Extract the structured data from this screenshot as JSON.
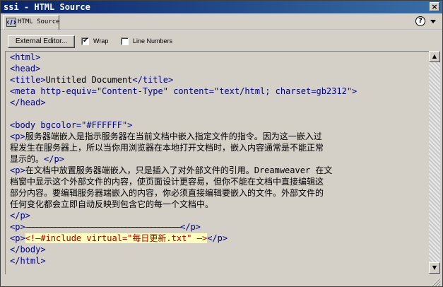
{
  "window": {
    "title": "ssi - HTML Source",
    "close_glyph": "×"
  },
  "tabs": [
    {
      "label": "HTML Source",
      "icon": "html-source-icon"
    }
  ],
  "panel": {
    "help_glyph": "?",
    "menu_icon": "panel-options-icon"
  },
  "toolbar": {
    "external_editor_label": "External Editor...",
    "wrap_label": "Wrap",
    "wrap_checked": true,
    "line_numbers_label": "Line Numbers",
    "line_numbers_checked": false
  },
  "code": {
    "l1": "<html>",
    "l2": "<head>",
    "l3_open": "<title>",
    "l3_text": "Untitled Document",
    "l3_close": "</title>",
    "l4": "<meta http-equiv=\"Content-Type\" content=\"text/html; charset=gb2312\">",
    "l5": "</head>",
    "l7": "<body bgcolor=\"#FFFFFF\">",
    "l8_open": "<p>",
    "l8_text": "服务器端嵌入是指示服务器在当前文档中嵌入指定文件的指令。因为这一嵌入过",
    "l9_text": "程发生在服务器上，所以当你用浏览器在本地打开文档时，嵌入内容通常是不能正常",
    "l10_text": "显示的。",
    "l10_close": "</p>",
    "l11_open": "<p>",
    "l11_text": "在文档中放置服务器端嵌入，只是插入了对外部文件的引用。Dreamweaver 在文",
    "l12_text": "档窗中显示这个外部文件的内容，使页面设计更容易，但你不能在文档中直接编辑这",
    "l13_text": "部分内容。要编辑服务器端嵌入的内容，你必须直接编辑要嵌入的文件。外部文件的",
    "l14_text": "任何变化都会立即自动反映到包含它的每一个文档中。",
    "l15": "</p>",
    "l16_open": "<p>",
    "l16_text": "——————————————————————————————————————————",
    "l16_close": "</p>",
    "l17_open": "<p>",
    "l17_include": "<!—#include virtual=\"每日更新.txt\" —>",
    "l17_close": "</p>",
    "l18": "</body>",
    "l19": "</html>"
  },
  "scrollbar": {
    "up_glyph": "▲",
    "down_glyph": "▼"
  }
}
